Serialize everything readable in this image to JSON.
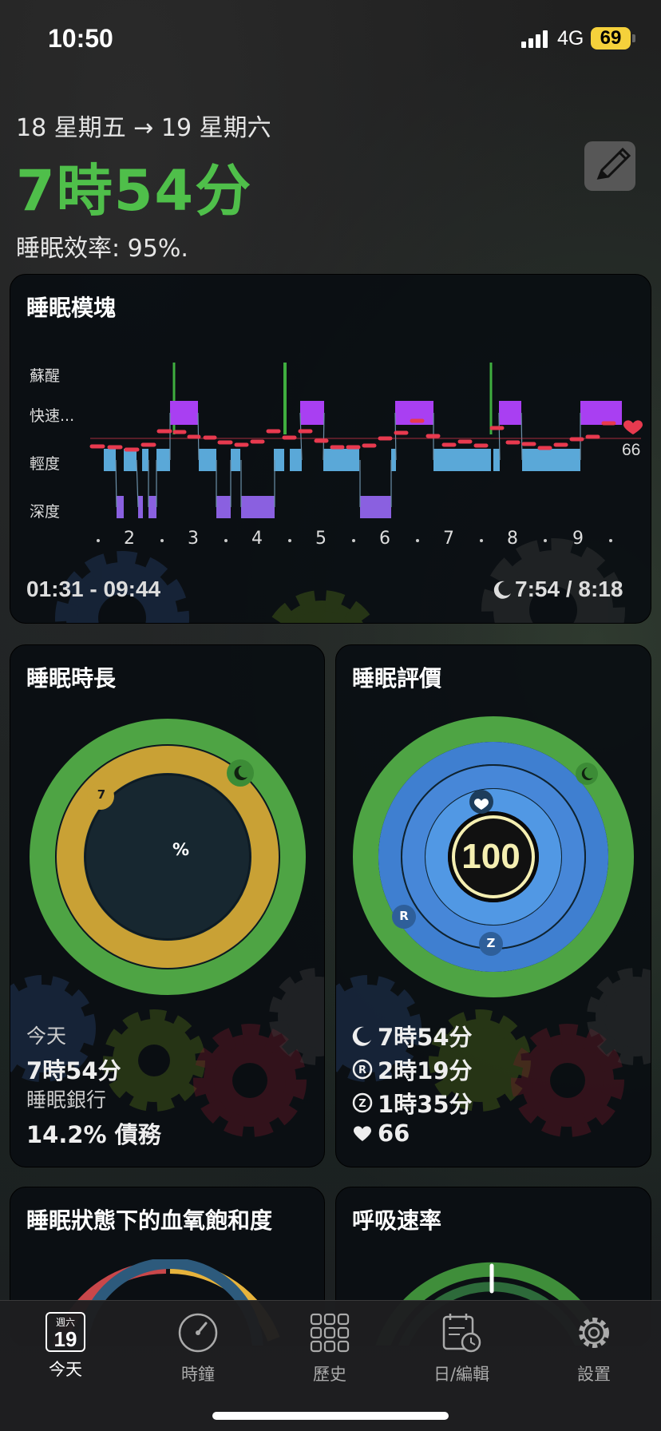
{
  "status": {
    "time": "10:50",
    "network": "4G",
    "battery": "69"
  },
  "header": {
    "date_range": "18 星期五 → 19 星期六",
    "duration": "7時54分",
    "efficiency": "睡眠效率: 95%."
  },
  "sleep_blocks": {
    "title": "睡眠模塊",
    "stages": [
      "蘇醒",
      "快速...",
      "輕度",
      "深度"
    ],
    "hour_ticks": [
      "2",
      "3",
      "4",
      "5",
      "6",
      "7",
      "8",
      "9"
    ],
    "heart_rate": "66",
    "time_range": "01:31 - 09:44",
    "ratio": "7:54 / 8:18"
  },
  "sleep_duration": {
    "title": "睡眠時長",
    "ring_badge": "7",
    "center_label": "%",
    "today_label": "今天",
    "today_value": "7時54分",
    "bank_label": "睡眠銀行",
    "bank_value": "14.2% 債務"
  },
  "sleep_score": {
    "title": "睡眠評價",
    "score": "100",
    "ring_r": "R",
    "ring_z": "Z",
    "stats": [
      {
        "icon": "moon-icon",
        "value": "7時54分"
      },
      {
        "icon": "r-icon",
        "value": "2時19分"
      },
      {
        "icon": "z-icon",
        "value": "1時35分"
      },
      {
        "icon": "heart-icon",
        "value": "66"
      }
    ]
  },
  "spo2": {
    "title": "睡眠狀態下的血氧飽和度"
  },
  "respiration": {
    "title": "呼吸速率"
  },
  "tabs": [
    {
      "label": "今天",
      "badge_top": "週六",
      "badge_num": "19"
    },
    {
      "label": "時鐘"
    },
    {
      "label": "歷史"
    },
    {
      "label": "日/編輯"
    },
    {
      "label": "設置"
    }
  ],
  "colors": {
    "accent_green": "#4fbf4a",
    "ring_gold": "#c9a135",
    "rem_purple": "#a93ff2",
    "light_blue": "#5aa8d8",
    "deep_purple": "#8a60e0",
    "heart_red": "#e83a4f"
  }
}
